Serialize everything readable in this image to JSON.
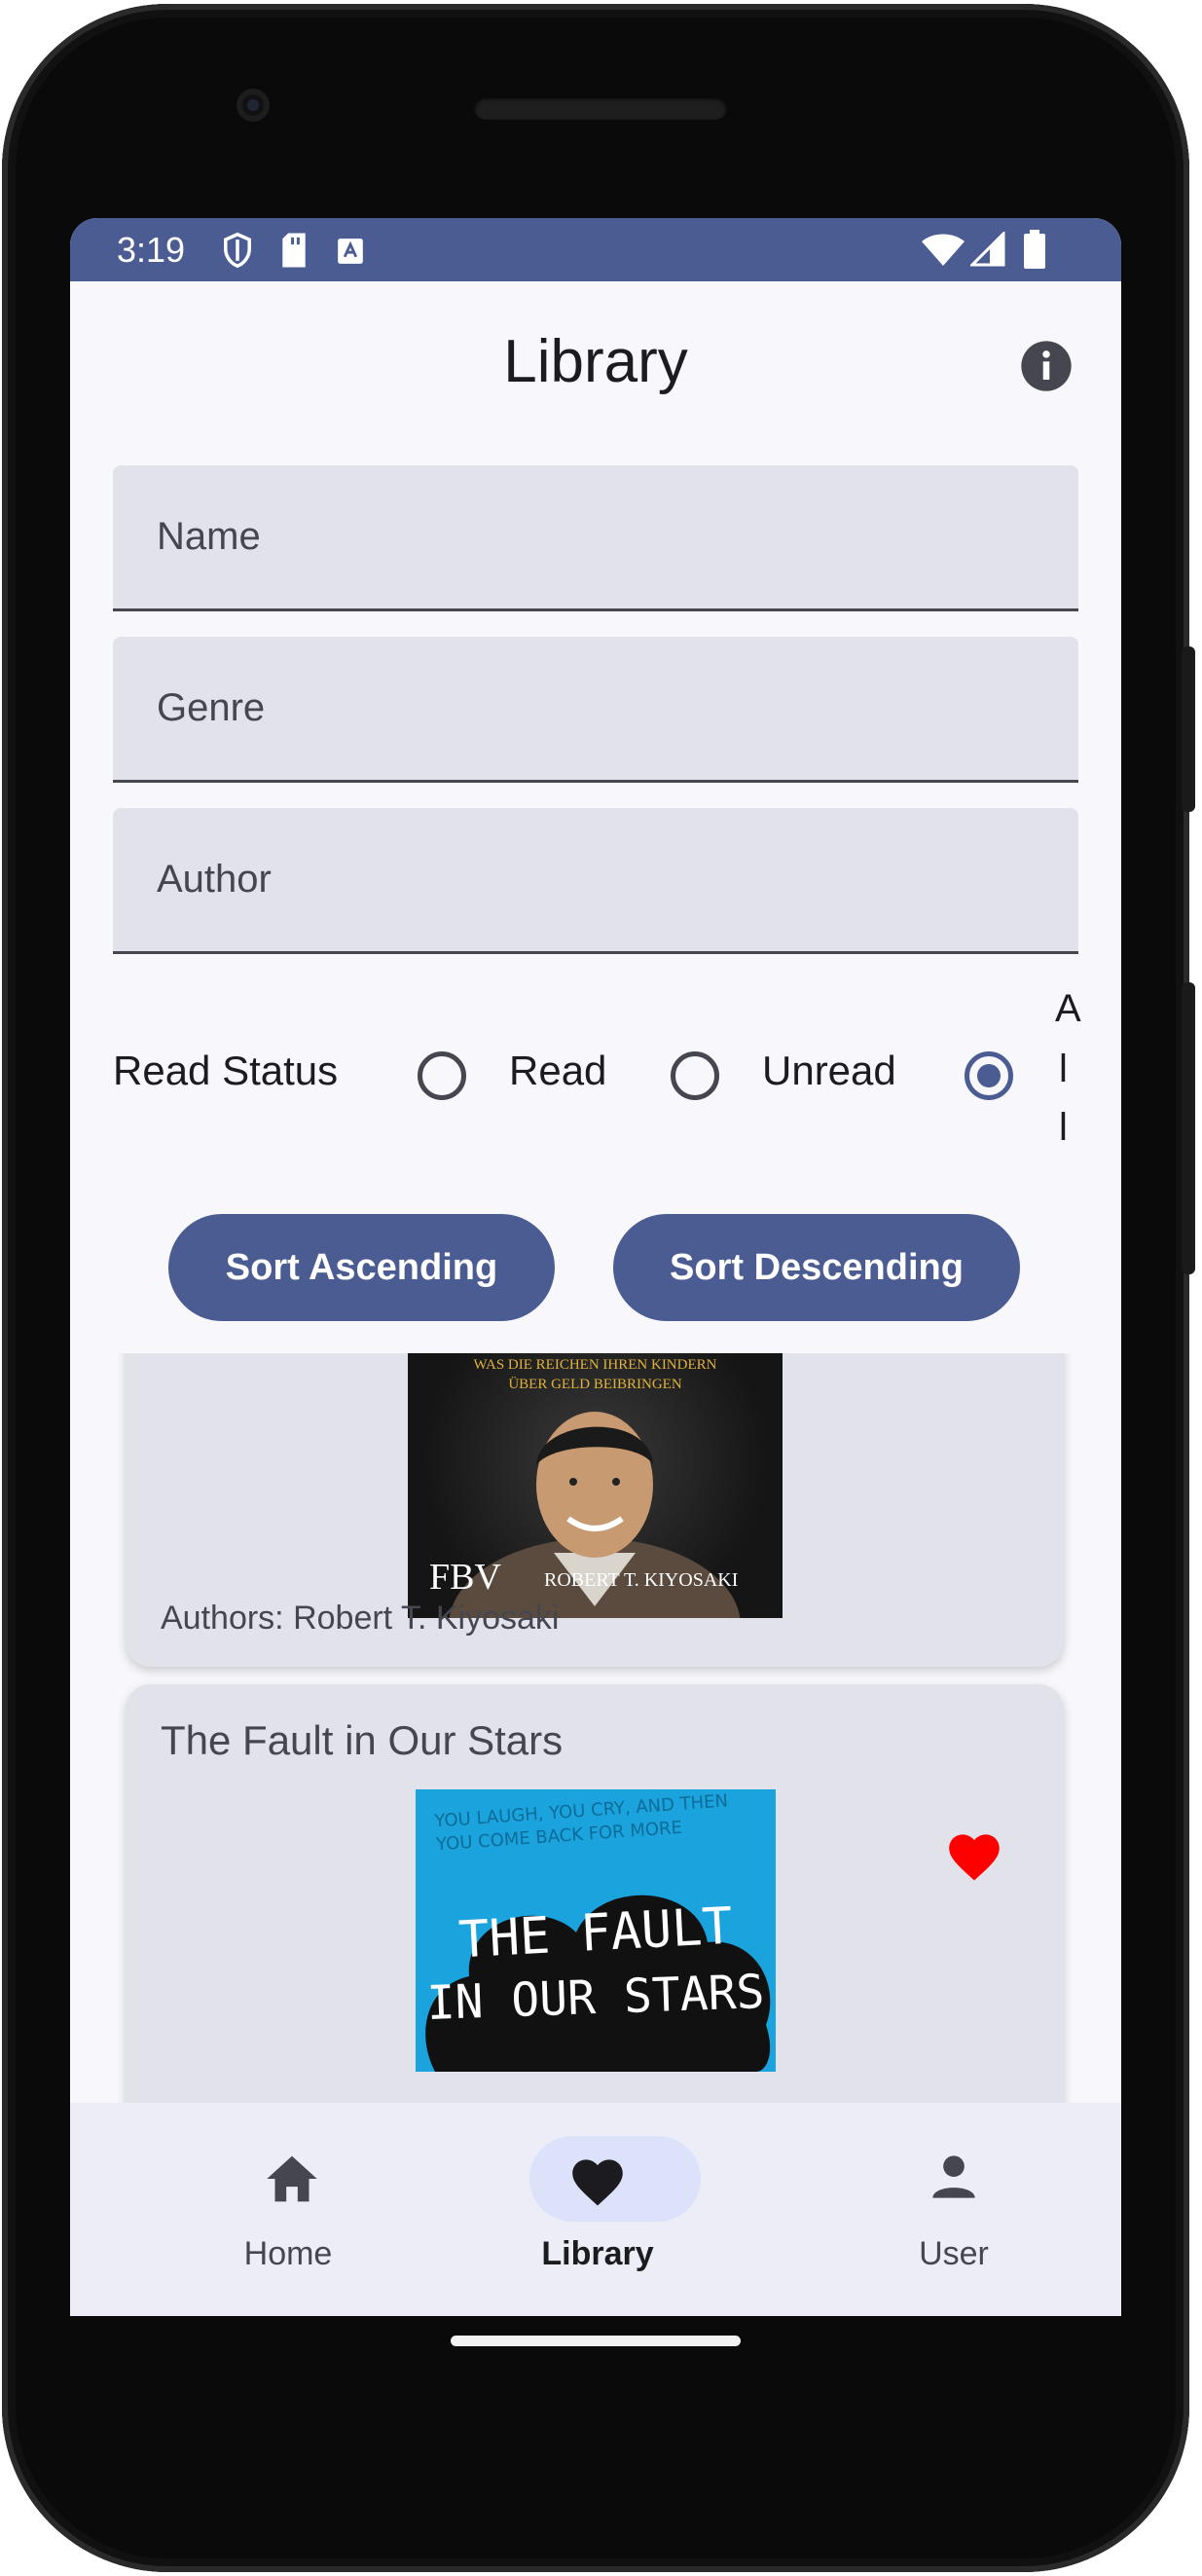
{
  "status_bar": {
    "time": "3:19"
  },
  "app_bar": {
    "title": "Library",
    "info_icon": "info-icon"
  },
  "filters": {
    "name_placeholder": "Name",
    "genre_placeholder": "Genre",
    "author_placeholder": "Author",
    "name_value": "",
    "genre_value": "",
    "author_value": ""
  },
  "read_status": {
    "label": "Read Status",
    "options": [
      "Read",
      "Unread",
      "All"
    ],
    "all_letters": [
      "A",
      "l",
      "l"
    ],
    "selected": "All"
  },
  "sort": {
    "ascending_label": "Sort Ascending",
    "descending_label": "Sort Descending"
  },
  "books": [
    {
      "title": "",
      "cover_text_top": "WAS DIE REICHEN IHREN KINDERN",
      "cover_text_top2": "ÜBER GELD BEIBRINGEN",
      "cover_publisher": "FBV",
      "cover_author": "ROBERT T. KIYOSAKI",
      "authors": "Authors: Robert T. Kiyosaki"
    },
    {
      "title": "The Fault in Our Stars",
      "cover_tagline": "YOU LAUGH, YOU CRY, AND THEN YOU COME BACK FOR MORE",
      "cover_title_line1": "THE FAULT",
      "cover_title_line2": "IN OUR STARS",
      "favorite": true,
      "favorite_color": "#ff0000"
    }
  ],
  "bottom_nav": {
    "items": [
      {
        "label": "Home",
        "icon": "home-icon"
      },
      {
        "label": "Library",
        "icon": "heart-icon",
        "active": true
      },
      {
        "label": "User",
        "icon": "person-icon"
      }
    ]
  },
  "colors": {
    "primary": "#4a5c92",
    "surface": "#f8f8fc",
    "field": "#e2e2ea",
    "favorite": "#ff0000"
  }
}
